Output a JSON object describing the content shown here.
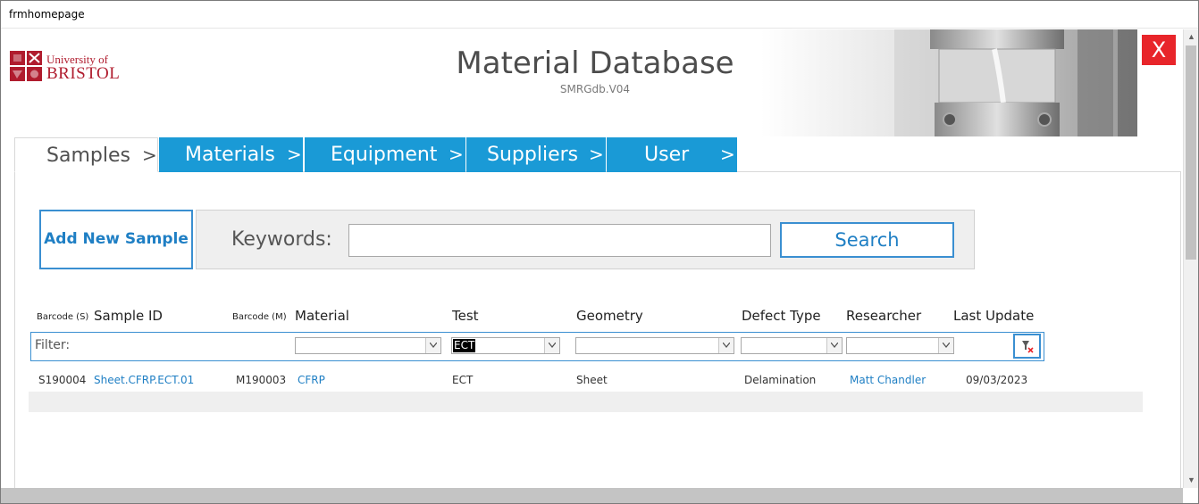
{
  "window": {
    "title": "frmhomepage"
  },
  "header": {
    "logo_line1": "University of",
    "logo_line2": "BRISTOL",
    "app_title": "Material Database",
    "version": "SMRGdb.V04",
    "close_label": "X"
  },
  "tabs": [
    {
      "label": "Samples",
      "arrow": ">"
    },
    {
      "label": "Materials",
      "arrow": ">"
    },
    {
      "label": "Equipment",
      "arrow": ">"
    },
    {
      "label": "Suppliers",
      "arrow": ">"
    },
    {
      "label": "User",
      "arrow": ">"
    }
  ],
  "search": {
    "add_label": "Add New Sample",
    "keywords_label": "Keywords:",
    "keywords_value": "",
    "search_label": "Search"
  },
  "columns": {
    "barcode_s": "Barcode (S)",
    "sample_id": "Sample ID",
    "barcode_m": "Barcode (M)",
    "material": "Material",
    "test": "Test",
    "geometry": "Geometry",
    "defect_type": "Defect Type",
    "researcher": "Researcher",
    "last_update": "Last Update"
  },
  "filters": {
    "label": "Filter:",
    "material": "",
    "test": "ECT",
    "geometry": "",
    "defect_type": "",
    "researcher": ""
  },
  "rows": [
    {
      "barcode_s": "S190004",
      "sample_id": "Sheet.CFRP.ECT.01",
      "barcode_m": "M190003",
      "material": "CFRP",
      "test": "ECT",
      "geometry": "Sheet",
      "defect_type": "Delamination",
      "researcher": "Matt Chandler",
      "last_update": "09/03/2023"
    }
  ],
  "colors": {
    "accent": "#1a9ad6",
    "link": "#1f7fc4",
    "close": "#e8252a",
    "brand": "#b01c2e"
  },
  "icons": {
    "close": "close-icon",
    "clear_filter": "clear-filter-icon",
    "dropdown": "chevron-down-icon"
  }
}
